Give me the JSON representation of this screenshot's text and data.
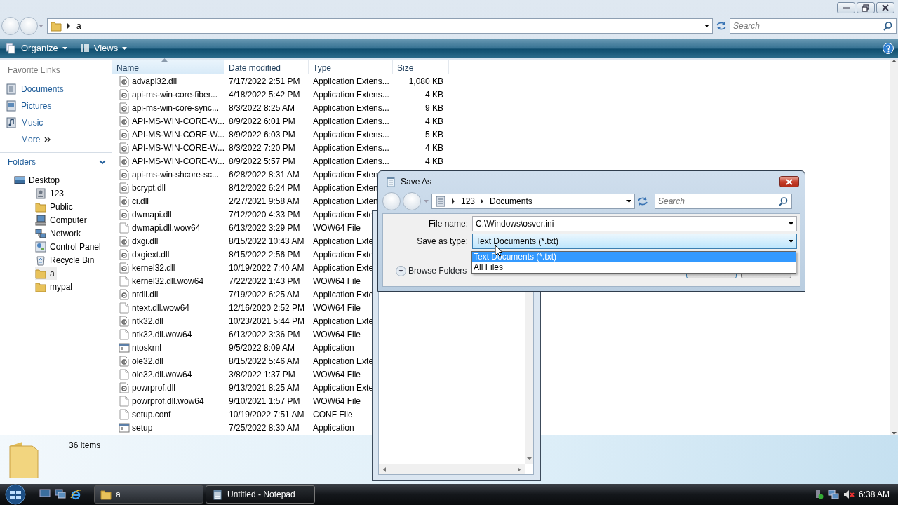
{
  "explorer": {
    "address": {
      "path": [
        "a"
      ]
    },
    "search": {
      "placeholder": "Search"
    },
    "toolbar": [
      {
        "label": "Organize",
        "kind": "organize"
      },
      {
        "label": "Views",
        "kind": "views"
      }
    ],
    "favorite_links": {
      "title": "Favorite Links",
      "items": [
        {
          "label": "Documents",
          "kind": "documents"
        },
        {
          "label": "Pictures",
          "kind": "pictures"
        },
        {
          "label": "Music",
          "kind": "music"
        }
      ],
      "more": "More"
    },
    "folders": {
      "title": "Folders",
      "tree": [
        {
          "label": "Desktop",
          "kind": "desktop",
          "selected": false,
          "children": [
            {
              "label": "123",
              "kind": "user",
              "selected": false
            },
            {
              "label": "Public",
              "kind": "folder",
              "selected": false
            },
            {
              "label": "Computer",
              "kind": "computer",
              "selected": false
            },
            {
              "label": "Network",
              "kind": "network",
              "selected": false
            },
            {
              "label": "Control Panel",
              "kind": "control",
              "selected": false
            },
            {
              "label": "Recycle Bin",
              "kind": "recycle",
              "selected": false
            },
            {
              "label": "a",
              "kind": "folder",
              "selected": true
            },
            {
              "label": "mypal",
              "kind": "folder",
              "selected": false
            }
          ]
        }
      ]
    },
    "table": {
      "columns": [
        {
          "label": "Name",
          "sorted": true
        },
        {
          "label": "Date modified",
          "sorted": false
        },
        {
          "label": "Type",
          "sorted": false
        },
        {
          "label": "Size",
          "sorted": false
        }
      ],
      "rows": [
        {
          "name": "advapi32.dll",
          "date": "7/17/2022 2:51 PM",
          "type": "Application Extens...",
          "size": "1,080 KB",
          "kind": "dll"
        },
        {
          "name": "api-ms-win-core-fiber...",
          "date": "4/18/2022 5:42 PM",
          "type": "Application Extens...",
          "size": "4 KB",
          "kind": "dll"
        },
        {
          "name": "api-ms-win-core-sync...",
          "date": "8/3/2022 8:25 AM",
          "type": "Application Extens...",
          "size": "9 KB",
          "kind": "dll"
        },
        {
          "name": "API-MS-WIN-CORE-W...",
          "date": "8/9/2022 6:01 PM",
          "type": "Application Extens...",
          "size": "4 KB",
          "kind": "dll"
        },
        {
          "name": "API-MS-WIN-CORE-W...",
          "date": "8/9/2022 6:03 PM",
          "type": "Application Extens...",
          "size": "5 KB",
          "kind": "dll"
        },
        {
          "name": "API-MS-WIN-CORE-W...",
          "date": "8/3/2022 7:20 PM",
          "type": "Application Extens...",
          "size": "4 KB",
          "kind": "dll"
        },
        {
          "name": "API-MS-WIN-CORE-W...",
          "date": "8/9/2022 5:57 PM",
          "type": "Application Extens...",
          "size": "4 KB",
          "kind": "dll"
        },
        {
          "name": "api-ms-win-shcore-sc...",
          "date": "6/28/2022 8:31 AM",
          "type": "Application Exten",
          "kind": "dll"
        },
        {
          "name": "bcrypt.dll",
          "date": "8/12/2022 6:24 PM",
          "type": "Application Exten",
          "kind": "dll"
        },
        {
          "name": "ci.dll",
          "date": "2/27/2021 9:58 AM",
          "type": "Application Exten",
          "kind": "dll"
        },
        {
          "name": "dwmapi.dll",
          "date": "7/12/2020 4:33 PM",
          "type": "Application Exte",
          "kind": "dll"
        },
        {
          "name": "dwmapi.dll.wow64",
          "date": "6/13/2022 3:29 PM",
          "type": "WOW64 File",
          "kind": "file"
        },
        {
          "name": "dxgi.dll",
          "date": "8/15/2022 10:43 AM",
          "type": "Application Exte",
          "kind": "dll"
        },
        {
          "name": "dxgiext.dll",
          "date": "8/15/2022 2:56 PM",
          "type": "Application Exte",
          "kind": "dll"
        },
        {
          "name": "kernel32.dll",
          "date": "10/19/2022 7:40 AM",
          "type": "Application Exte",
          "kind": "dll"
        },
        {
          "name": "kernel32.dll.wow64",
          "date": "7/22/2022 1:43 PM",
          "type": "WOW64 File",
          "kind": "file"
        },
        {
          "name": "ntdll.dll",
          "date": "7/19/2022 6:25 AM",
          "type": "Application Exte",
          "kind": "dll"
        },
        {
          "name": "ntext.dll.wow64",
          "date": "12/16/2020 2:52 PM",
          "type": "WOW64 File",
          "kind": "file"
        },
        {
          "name": "ntk32.dll",
          "date": "10/23/2021 5:44 PM",
          "type": "Application Exte",
          "kind": "dll"
        },
        {
          "name": "ntk32.dll.wow64",
          "date": "6/13/2022 3:36 PM",
          "type": "WOW64 File",
          "kind": "file"
        },
        {
          "name": "ntoskrnl",
          "date": "9/5/2022 8:09 AM",
          "type": "Application",
          "kind": "app"
        },
        {
          "name": "ole32.dll",
          "date": "8/15/2022 5:46 AM",
          "type": "Application Exte",
          "kind": "dll"
        },
        {
          "name": "ole32.dll.wow64",
          "date": "3/8/2022 1:37 PM",
          "type": "WOW64 File",
          "kind": "file"
        },
        {
          "name": "powrprof.dll",
          "date": "9/13/2021 8:25 AM",
          "type": "Application Exte",
          "kind": "dll"
        },
        {
          "name": "powrprof.dll.wow64",
          "date": "9/10/2021 1:57 PM",
          "type": "WOW64 File",
          "kind": "file"
        },
        {
          "name": "setup.conf",
          "date": "10/19/2022 7:51 AM",
          "type": "CONF File",
          "kind": "file"
        },
        {
          "name": "setup",
          "date": "7/25/2022 8:30 AM",
          "type": "Application",
          "kind": "app"
        }
      ]
    },
    "status": {
      "count": "36 items"
    }
  },
  "save_dialog": {
    "title": "Save As",
    "path": [
      "123",
      "Documents"
    ],
    "search": {
      "placeholder": "Search"
    },
    "file_name": {
      "label": "File name:",
      "value": "C:\\Windows\\osver.ini"
    },
    "save_as_type": {
      "label": "Save as type:",
      "value": "Text Documents (*.txt)",
      "expanded": true,
      "options": [
        {
          "label": "Text Documents (*.txt)",
          "selected": true
        },
        {
          "label": "All Files",
          "selected": false
        }
      ]
    },
    "browse_folders": "Browse Folders"
  },
  "taskbar": {
    "items": [
      {
        "label": "a",
        "kind": "folder",
        "active": false
      },
      {
        "label": "Untitled - Notepad",
        "kind": "notepad",
        "active": true
      }
    ],
    "clock": "6:38 AM"
  }
}
